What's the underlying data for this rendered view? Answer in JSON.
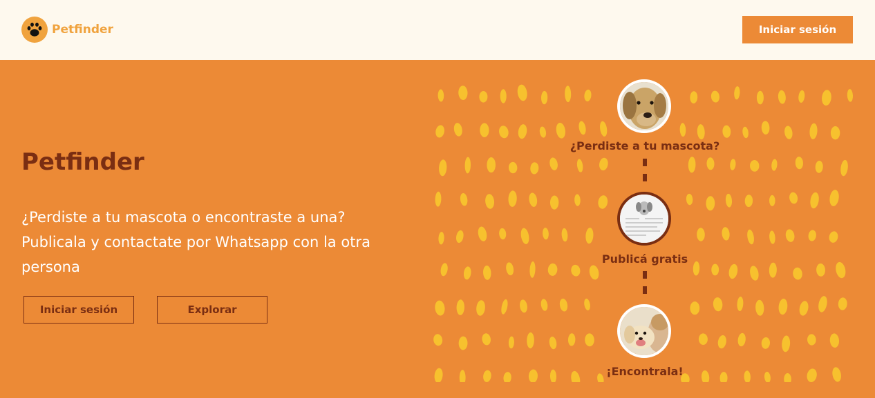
{
  "header": {
    "brand_name": "Petfinder",
    "login_label": "Iniciar sesión",
    "logo_icon": "paw-icon"
  },
  "hero": {
    "title": "Petfinder",
    "description": "¿Perdiste a tu mascota o encontraste a una? Publicala y contactate por Whatsapp con la otra persona",
    "login_label": "Iniciar sesión",
    "explore_label": "Explorar"
  },
  "steps": [
    {
      "label": "¿Perdiste a tu mascota?",
      "image": "dog-face-photo"
    },
    {
      "label": "Publicá gratis",
      "image": "lost-dog-poster"
    },
    {
      "label": "¡Encontrala!",
      "image": "puppy-hug-photo"
    }
  ],
  "colors": {
    "primary": "#ec8a36",
    "dark": "#7a2e12",
    "accent": "#f0a33e",
    "dot": "#f7c12e",
    "header_bg": "#fef9ee"
  }
}
